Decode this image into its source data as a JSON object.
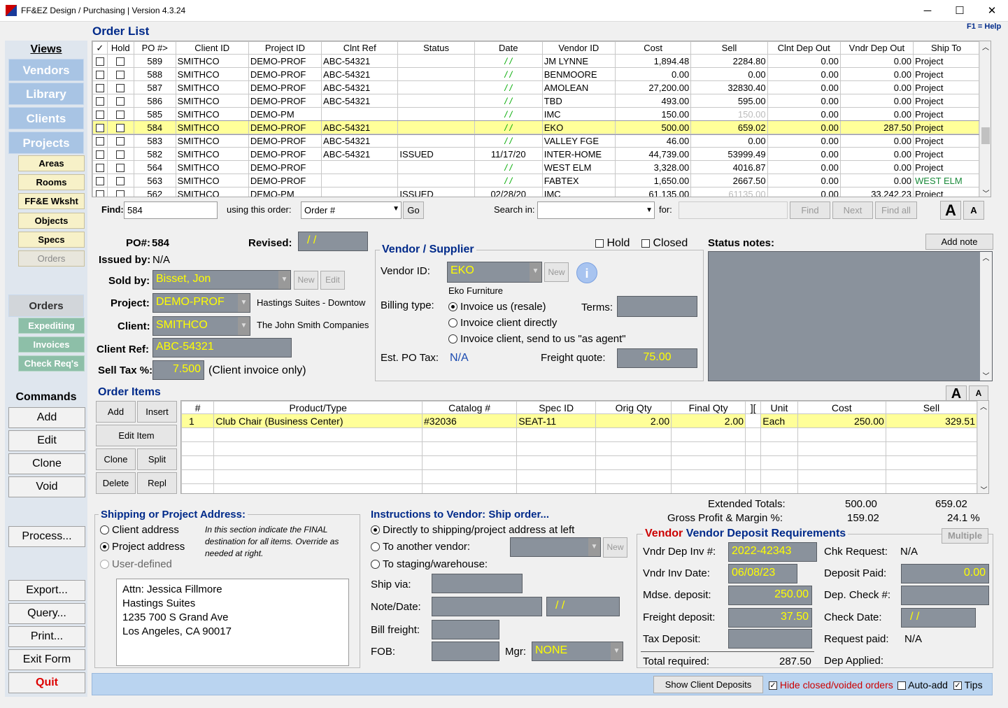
{
  "app": {
    "title": "FF&EZ Design / Purchasing | Version 4.3.24",
    "minimize": "─",
    "maximize": "☐",
    "close": "✕"
  },
  "header": {
    "title": "Order List",
    "help": "F1 = Help"
  },
  "sidebar": {
    "views": "Views",
    "vendors": "Vendors",
    "library": "Library",
    "clients": "Clients",
    "projects": "Projects",
    "sub": [
      "Areas",
      "Rooms",
      "FF&E Wksht",
      "Objects",
      "Specs",
      "Orders"
    ],
    "orders": "Orders",
    "orders_sub": [
      "Expediting",
      "Invoices",
      "Check Req's"
    ],
    "commands": "Commands",
    "cmds": [
      "Add",
      "Edit",
      "Clone",
      "Void"
    ],
    "process": "Process...",
    "cmds2": [
      "Export...",
      "Query...",
      "Print...",
      "Exit Form"
    ],
    "quit": "Quit"
  },
  "order_list": {
    "columns": [
      "✓",
      "Hold",
      "PO #>",
      "Client ID",
      "Project ID",
      "Clnt Ref",
      "Status",
      "Date",
      "Vendor ID",
      "Cost",
      "Sell",
      "Clnt Dep Out",
      "Vndr Dep Out",
      "Ship To"
    ],
    "rows": [
      [
        "589",
        "SMITHCO",
        "DEMO-PROF",
        "ABC-54321",
        "",
        "/ /",
        "JM LYNNE",
        "1,894.48",
        "2284.80",
        "0.00",
        "0.00",
        "Project"
      ],
      [
        "588",
        "SMITHCO",
        "DEMO-PROF",
        "ABC-54321",
        "",
        "/ /",
        "BENMOORE",
        "0.00",
        "0.00",
        "0.00",
        "0.00",
        "Project"
      ],
      [
        "587",
        "SMITHCO",
        "DEMO-PROF",
        "ABC-54321",
        "",
        "/ /",
        "AMOLEAN",
        "27,200.00",
        "32830.40",
        "0.00",
        "0.00",
        "Project"
      ],
      [
        "586",
        "SMITHCO",
        "DEMO-PROF",
        "ABC-54321",
        "",
        "/ /",
        "TBD",
        "493.00",
        "595.00",
        "0.00",
        "0.00",
        "Project"
      ],
      [
        "585",
        "SMITHCO",
        "DEMO-PM",
        "",
        "",
        "/ /",
        "IMC",
        "150.00",
        "150.00",
        "0.00",
        "0.00",
        "Project"
      ],
      [
        "584",
        "SMITHCO",
        "DEMO-PROF",
        "ABC-54321",
        "",
        "/ /",
        "EKO",
        "500.00",
        "659.02",
        "0.00",
        "287.50",
        "Project"
      ],
      [
        "583",
        "SMITHCO",
        "DEMO-PROF",
        "ABC-54321",
        "",
        "/ /",
        "VALLEY FGE",
        "46.00",
        "0.00",
        "0.00",
        "0.00",
        "Project"
      ],
      [
        "582",
        "SMITHCO",
        "DEMO-PROF",
        "ABC-54321",
        "ISSUED",
        "11/17/20",
        "INTER-HOME",
        "44,739.00",
        "53999.49",
        "0.00",
        "0.00",
        "Project"
      ],
      [
        "564",
        "SMITHCO",
        "DEMO-PROF",
        "",
        "",
        "/ /",
        "WEST ELM",
        "3,328.00",
        "4016.87",
        "0.00",
        "0.00",
        "Project"
      ],
      [
        "563",
        "SMITHCO",
        "DEMO-PROF",
        "",
        "",
        "/ /",
        "FABTEX",
        "1,650.00",
        "2667.50",
        "0.00",
        "0.00",
        "WEST ELM"
      ],
      [
        "562",
        "SMITHCO",
        "DEMO-PM",
        "",
        "ISSUED",
        "02/28/20",
        "IMC",
        "61,135.00",
        "61135.00",
        "0.00",
        "33,242.23",
        "Project"
      ]
    ]
  },
  "find": {
    "label": "Find:",
    "value": "584",
    "order_label": "using this order:",
    "order_value": "Order #",
    "go": "Go",
    "search_label": "Search in:",
    "for_label": "for:",
    "find_btn": "Find",
    "next_btn": "Next",
    "findall_btn": "Find all",
    "fontA": "A",
    "fonta": "A"
  },
  "po": {
    "po_label": "PO#:",
    "po_value": "584",
    "revised_label": "Revised:",
    "revised_value": "/ /",
    "issued_label": "Issued by:",
    "issued_value": "N/A",
    "sold_label": "Sold by:",
    "sold_value": "Bisset, Jon",
    "new": "New",
    "edit": "Edit",
    "project_label": "Project:",
    "project_value": "DEMO-PROF",
    "project_desc": "Hastings Suites - Downtow",
    "client_label": "Client:",
    "client_value": "SMITHCO",
    "client_desc": "The John Smith Companies",
    "ref_label": "Client Ref:",
    "ref_value": "ABC-54321",
    "tax_label": "Sell Tax %:",
    "tax_value": "7.500",
    "tax_note": "(Client invoice only)"
  },
  "vendor": {
    "title": "Vendor / Supplier",
    "hold": "Hold",
    "closed": "Closed",
    "id_label": "Vendor ID:",
    "id_value": "EKO",
    "new": "New",
    "name": "Eko Furniture",
    "billing_label": "Billing type:",
    "opt1": "Invoice us (resale)",
    "opt2": "Invoice client directly",
    "opt3": "Invoice client, send to us \"as agent\"",
    "terms_label": "Terms:",
    "tax_label": "Est. PO Tax:",
    "tax_value": "N/A",
    "freight_label": "Freight quote:",
    "freight_value": "75.00"
  },
  "status": {
    "label": "Status notes:",
    "add_note": "Add note"
  },
  "items": {
    "title": "Order Items",
    "add": "Add",
    "insert": "Insert",
    "edit": "Edit Item",
    "clone": "Clone",
    "split": "Split",
    "delete": "Delete",
    "repl": "Repl",
    "columns": [
      "#",
      "Product/Type",
      "Catalog #",
      "Spec ID",
      "Orig Qty",
      "Final Qty",
      "][",
      "Unit",
      "Cost",
      "Sell"
    ],
    "rows": [
      [
        "1",
        "Club Chair (Business Center)",
        "#32036",
        "SEAT-11",
        "2.00",
        "2.00",
        "",
        "Each",
        "250.00",
        "329.51"
      ]
    ]
  },
  "shipping": {
    "title": "Shipping or Project Address:",
    "opt1": "Client address",
    "opt2": "Project address",
    "opt3": "User-defined",
    "note": "In this section indicate the FINAL destination for all items. Override as needed at right.",
    "addr": [
      "Attn: Jessica Fillmore",
      "Hastings Suites",
      "1235 700 S Grand Ave",
      "Los Angeles, CA 90017"
    ]
  },
  "instructions": {
    "title": "Instructions to Vendor: Ship order...",
    "opt1": "Directly to shipping/project address at left",
    "opt2": "To another vendor:",
    "opt3": "To staging/warehouse:",
    "new": "New",
    "shipvia": "Ship  via:",
    "notedate": "Note/Date:",
    "date_value": "/ /",
    "billfreight": "Bill freight:",
    "fob": "FOB:",
    "mgr": "Mgr:",
    "mgr_value": "NONE"
  },
  "totals": {
    "ext_label": "Extended Totals:",
    "ext_cost": "500.00",
    "ext_sell": "659.02",
    "gp_label": "Gross Profit & Margin %:",
    "gp_value": "159.02",
    "gp_pct": "24.1 %"
  },
  "deposit": {
    "title": "Vendor Deposit Requirements",
    "multiple": "Multiple",
    "inv_label": "Vndr Dep Inv #:",
    "inv_value": "2022-42343",
    "date_label": "Vndr Inv Date:",
    "date_value": "06/08/23",
    "mdse_label": "Mdse. deposit:",
    "mdse_value": "250.00",
    "freight_label": "Freight deposit:",
    "freight_value": "37.50",
    "tax_label": "Tax Deposit:",
    "total_label": "Total required:",
    "total_value": "287.50",
    "chk_label": "Chk Request:",
    "chk_value": "N/A",
    "paid_label": "Deposit Paid:",
    "paid_value": "0.00",
    "depchk_label": "Dep. Check #:",
    "chkdate_label": "Check Date:",
    "chkdate_value": "/ /",
    "reqpaid_label": "Request paid:",
    "reqpaid_value": "N/A",
    "applied_label": "Dep Applied:"
  },
  "footer": {
    "show_deposits": "Show Client Deposits",
    "hide_closed": "Hide closed/voided orders",
    "autoadd": "Auto-add",
    "tips": "Tips"
  }
}
